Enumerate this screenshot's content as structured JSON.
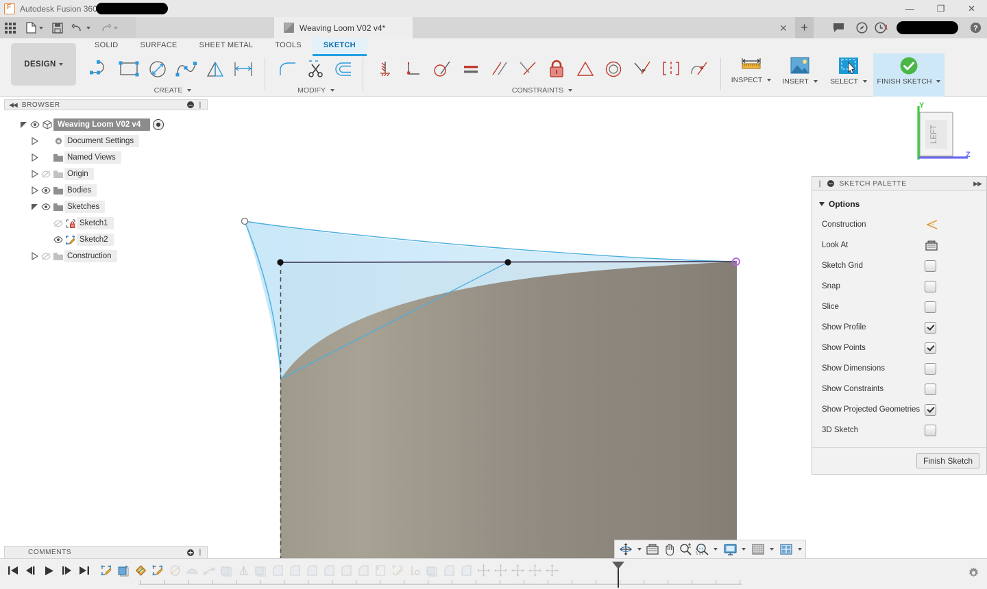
{
  "titlebar": {
    "app_name": "Autodesk Fusion 360",
    "redacted": true,
    "window_buttons": {
      "minimize": "—",
      "maximize": "❐",
      "close": "✕"
    }
  },
  "quick_access": {
    "items": [
      {
        "name": "app-grid",
        "icon": "grid-icon"
      },
      {
        "name": "new-file",
        "icon": "file-icon",
        "has_caret": true
      },
      {
        "name": "save",
        "icon": "save-icon"
      },
      {
        "name": "undo",
        "icon": "undo-icon",
        "has_caret": true
      },
      {
        "name": "redo",
        "icon": "redo-icon",
        "has_caret": true
      }
    ]
  },
  "document_tab": {
    "label": "Weaving Loom V02 v4*",
    "close_label": "✕",
    "new_tab_label": "+"
  },
  "titlebar_right": {
    "notifications_icon": "comment-icon",
    "help_compass_icon": "compass-icon",
    "job_status_icon": "clock-icon",
    "job_count": "1",
    "account_redacted": true,
    "help_icon": "question-icon"
  },
  "ribbon": {
    "design_dropdown": "DESIGN",
    "workspace_tabs": [
      {
        "label": "SOLID",
        "active": false
      },
      {
        "label": "SURFACE",
        "active": false
      },
      {
        "label": "SHEET METAL",
        "active": false
      },
      {
        "label": "TOOLS",
        "active": false
      },
      {
        "label": "SKETCH",
        "active": true
      }
    ],
    "panels": [
      {
        "label": "CREATE",
        "has_caret": true,
        "commands": [
          {
            "name": "line-tool",
            "icon": "line-arc-icon"
          },
          {
            "name": "rectangle-tool",
            "icon": "rectangle-icon"
          },
          {
            "name": "circle-tool",
            "icon": "circle-diameter-icon"
          },
          {
            "name": "spline-tool",
            "icon": "spline-icon"
          },
          {
            "name": "mirror-tool",
            "icon": "mirror-icon"
          },
          {
            "name": "sketch-dimension-tool",
            "icon": "dimension-icon"
          }
        ]
      },
      {
        "label": "MODIFY",
        "has_caret": true,
        "commands": [
          {
            "name": "fillet-tool",
            "icon": "fillet-icon"
          },
          {
            "name": "trim-tool",
            "icon": "scissors-icon"
          },
          {
            "name": "offset-tool",
            "icon": "offset-icon"
          }
        ]
      },
      {
        "label": "CONSTRAINTS",
        "has_caret": true,
        "commands": [
          {
            "name": "constraint-fix",
            "icon": "fix-ground-icon"
          },
          {
            "name": "constraint-perpendicular",
            "icon": "perpendicular-icon"
          },
          {
            "name": "constraint-tangent",
            "icon": "tangent-icon"
          },
          {
            "name": "constraint-equal",
            "icon": "equal-icon"
          },
          {
            "name": "constraint-parallel",
            "icon": "parallel-icon"
          },
          {
            "name": "constraint-collinear",
            "icon": "collinear-icon"
          },
          {
            "name": "constraint-fix-unfix",
            "icon": "lock-icon"
          },
          {
            "name": "constraint-midpoint",
            "icon": "triangle-icon"
          },
          {
            "name": "constraint-concentric",
            "icon": "concentric-icon"
          },
          {
            "name": "constraint-coincident",
            "icon": "coincident-icon"
          },
          {
            "name": "constraint-symmetry",
            "icon": "symmetry-icon"
          },
          {
            "name": "constraint-curvature",
            "icon": "curvature-icon"
          }
        ]
      }
    ],
    "right_commands": [
      {
        "name": "inspect",
        "label": "INSPECT",
        "icon": "ruler-icon",
        "has_caret": true,
        "highlighted": false
      },
      {
        "name": "insert",
        "label": "INSERT",
        "icon": "image-icon",
        "has_caret": true,
        "highlighted": false
      },
      {
        "name": "select",
        "label": "SELECT",
        "icon": "select-cursor-icon",
        "has_caret": true,
        "highlighted": false
      },
      {
        "name": "finish-sketch",
        "label": "FINISH SKETCH",
        "icon": "green-check-icon",
        "has_caret": true,
        "highlighted": true
      }
    ]
  },
  "browser": {
    "header": "BROWSER",
    "collapse_icon": "double-chevron-left-icon",
    "minimize_icon": "minus-circle-icon",
    "tree": [
      {
        "label": "Weaving Loom V02 v4",
        "depth": 0,
        "expander": "expanded",
        "eye": "visible",
        "icon": "component-icon",
        "selected": true,
        "has_activate_dot": true
      },
      {
        "label": "Document Settings",
        "depth": 1,
        "expander": "collapsed",
        "eye": "none",
        "icon": "gear-icon",
        "selected": false
      },
      {
        "label": "Named Views",
        "depth": 1,
        "expander": "collapsed",
        "eye": "none",
        "icon": "folder-icon",
        "selected": false
      },
      {
        "label": "Origin",
        "depth": 1,
        "expander": "collapsed",
        "eye": "hidden",
        "icon": "folder-icon",
        "selected": false
      },
      {
        "label": "Bodies",
        "depth": 1,
        "expander": "collapsed",
        "eye": "visible",
        "icon": "folder-icon",
        "selected": false
      },
      {
        "label": "Sketches",
        "depth": 1,
        "expander": "expanded",
        "eye": "visible",
        "icon": "folder-icon",
        "selected": false
      },
      {
        "label": "Sketch1",
        "depth": 2,
        "expander": "none",
        "eye": "hidden",
        "icon": "sketch-locked-icon",
        "selected": false
      },
      {
        "label": "Sketch2",
        "depth": 2,
        "expander": "none",
        "eye": "visible",
        "icon": "sketch-edit-icon",
        "selected": false
      },
      {
        "label": "Construction",
        "depth": 1,
        "expander": "collapsed",
        "eye": "hidden",
        "icon": "folder-icon",
        "selected": false
      }
    ]
  },
  "comments": {
    "header": "COMMENTS",
    "add_icon": "plus-circle-icon"
  },
  "viewport": {
    "view_cube": {
      "face_label": "LEFT",
      "axis_y": "Y",
      "axis_z": "Z"
    },
    "nav_bar": [
      {
        "name": "orbit-tool",
        "icon": "orbit-icon",
        "has_caret": true
      },
      {
        "name": "look-at-tool",
        "icon": "look-at-icon",
        "has_caret": false
      },
      {
        "name": "pan-tool",
        "icon": "hand-icon",
        "has_caret": false
      },
      {
        "name": "zoom-tool",
        "icon": "zoom-plusminus-icon",
        "has_caret": false
      },
      {
        "name": "zoom-window-tool",
        "icon": "zoom-window-icon",
        "has_caret": true
      },
      {
        "name": "display-settings",
        "icon": "monitor-icon",
        "has_caret": true
      },
      {
        "name": "grid-settings",
        "icon": "grid-snap-icon",
        "has_caret": true
      },
      {
        "name": "viewports-layout",
        "icon": "viewports-icon",
        "has_caret": true
      }
    ],
    "sketch": {
      "profile_fill_color": "#cfe9f7",
      "profile_edge_color": "#4aaede",
      "body_edge_color": "#4a3f5e",
      "selected_point_color": "#b06ae0",
      "point_color": "#111111"
    }
  },
  "sketch_palette": {
    "header": "SKETCH PALETTE",
    "minimize_icon": "minus-circle-icon",
    "expand_icon": "double-chevron-right-icon",
    "section_label": "Options",
    "options": [
      {
        "label": "Construction",
        "control": "icon",
        "icon": "construction-line-icon",
        "checked": false
      },
      {
        "label": "Look At",
        "control": "icon",
        "icon": "look-at-icon",
        "checked": false
      },
      {
        "label": "Sketch Grid",
        "control": "checkbox",
        "checked": false
      },
      {
        "label": "Snap",
        "control": "checkbox",
        "checked": false
      },
      {
        "label": "Slice",
        "control": "checkbox",
        "checked": false
      },
      {
        "label": "Show Profile",
        "control": "checkbox",
        "checked": true
      },
      {
        "label": "Show Points",
        "control": "checkbox",
        "checked": true
      },
      {
        "label": "Show Dimensions",
        "control": "checkbox",
        "checked": false
      },
      {
        "label": "Show Constraints",
        "control": "checkbox",
        "checked": false
      },
      {
        "label": "Show Projected Geometries",
        "control": "checkbox",
        "checked": true
      },
      {
        "label": "3D Sketch",
        "control": "checkbox",
        "checked": false
      }
    ],
    "finish_button": "Finish Sketch"
  },
  "timeline": {
    "playback": [
      {
        "name": "go-to-beginning",
        "icon": "skip-start-icon"
      },
      {
        "name": "step-back",
        "icon": "step-back-icon"
      },
      {
        "name": "play",
        "icon": "play-icon"
      },
      {
        "name": "step-forward",
        "icon": "step-forward-icon"
      },
      {
        "name": "go-to-end",
        "icon": "skip-end-icon"
      }
    ],
    "features": [
      {
        "name": "sketch-feature",
        "icon": "sketch-icon",
        "dim": false
      },
      {
        "name": "extrude-feature",
        "icon": "extrude-icon",
        "dim": false
      },
      {
        "name": "appearance-feature",
        "icon": "appearance-icon",
        "dim": false
      },
      {
        "name": "sketch-feature",
        "icon": "sketch-icon",
        "dim": false
      },
      {
        "name": "revolve-feature",
        "icon": "revolve-icon",
        "dim": true
      },
      {
        "name": "loft-feature",
        "icon": "loft-icon",
        "dim": true
      },
      {
        "name": "sweep-feature",
        "icon": "sweep-icon",
        "dim": true
      },
      {
        "name": "extrude-feature",
        "icon": "extrude-icon",
        "dim": true
      },
      {
        "name": "mirror-feature",
        "icon": "mirror-icon",
        "dim": true
      },
      {
        "name": "extrude-feature",
        "icon": "extrude-icon",
        "dim": true
      },
      {
        "name": "fillet-feature",
        "icon": "fillet-icon",
        "dim": true
      },
      {
        "name": "fillet-feature",
        "icon": "fillet-icon",
        "dim": true
      },
      {
        "name": "fillet-feature",
        "icon": "fillet-icon",
        "dim": true
      },
      {
        "name": "fillet-feature",
        "icon": "fillet-icon",
        "dim": true
      },
      {
        "name": "shell-feature",
        "icon": "shell-icon",
        "dim": true
      },
      {
        "name": "chamfer-feature",
        "icon": "chamfer-icon",
        "dim": true
      },
      {
        "name": "split-feature",
        "icon": "split-icon",
        "dim": true
      },
      {
        "name": "sketch-feature",
        "icon": "sketch-icon",
        "dim": true
      },
      {
        "name": "construction-feature",
        "icon": "construction-icon",
        "dim": true
      },
      {
        "name": "extrude-feature",
        "icon": "extrude-icon",
        "dim": true
      },
      {
        "name": "fillet-feature",
        "icon": "fillet-icon",
        "dim": true
      },
      {
        "name": "fillet-feature",
        "icon": "fillet-icon",
        "dim": true
      },
      {
        "name": "move-feature",
        "icon": "move-icon",
        "dim": true
      },
      {
        "name": "move-feature",
        "icon": "move-icon",
        "dim": true
      },
      {
        "name": "move-feature",
        "icon": "move-icon",
        "dim": true
      },
      {
        "name": "move-feature",
        "icon": "move-icon",
        "dim": true
      },
      {
        "name": "move-feature",
        "icon": "move-icon",
        "dim": true
      }
    ],
    "settings_icon": "gear-icon"
  }
}
